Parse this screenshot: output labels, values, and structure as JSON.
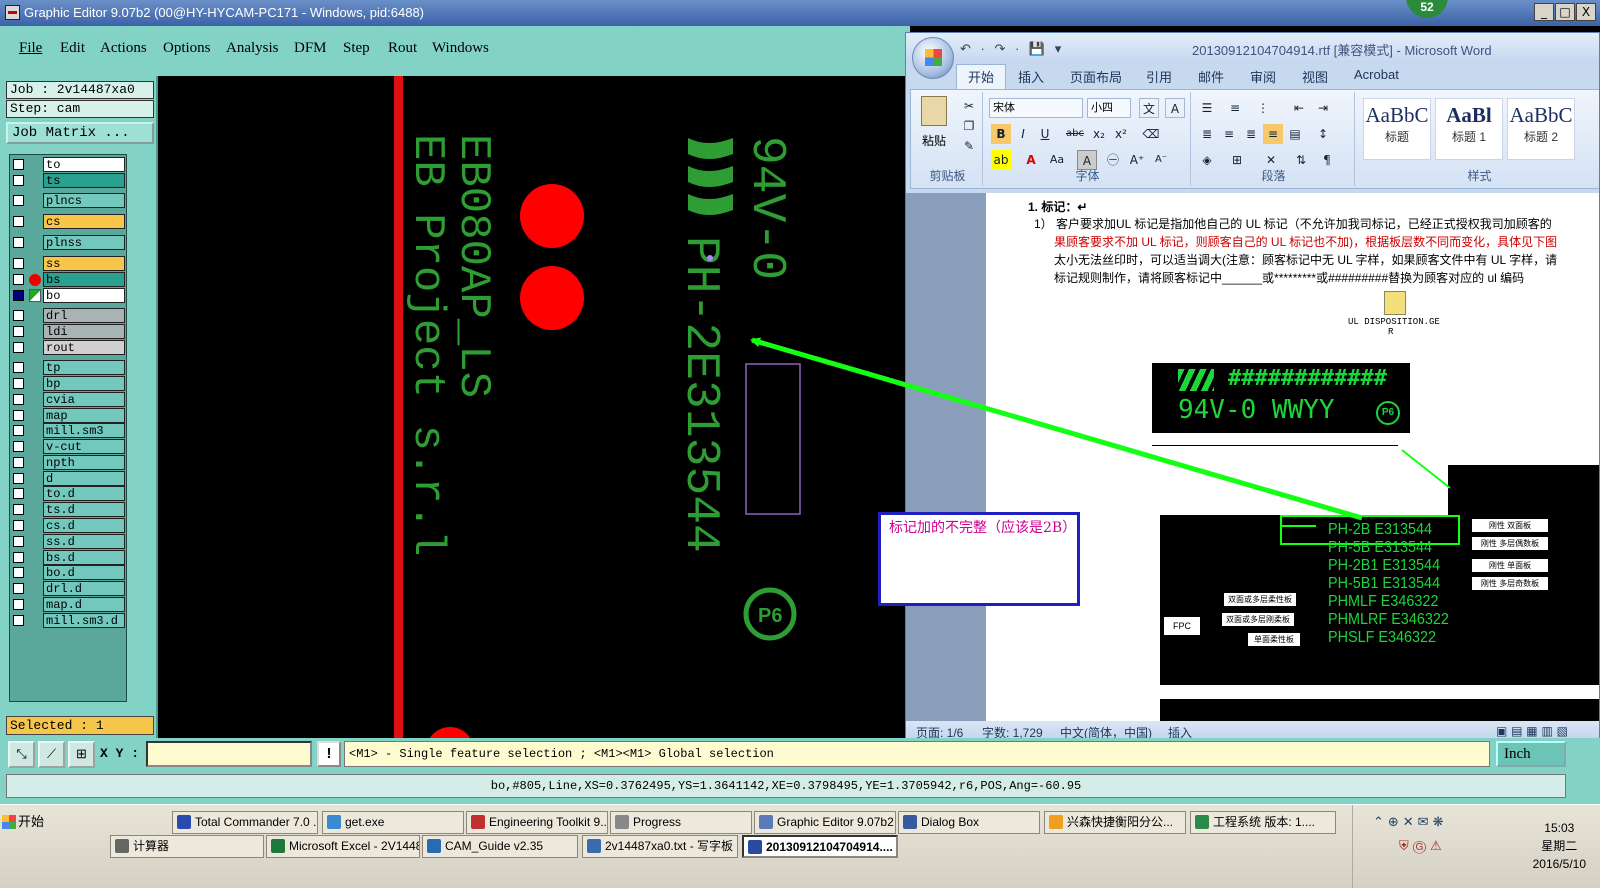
{
  "ge": {
    "title": "Graphic Editor 9.07b2 (00@HY-HYCAM-PC171 - Windows, pid:6488)",
    "window_buttons": [
      "_",
      "□",
      "X"
    ],
    "badge": "52",
    "menus": [
      "File",
      "Edit",
      "Actions",
      "Options",
      "Analysis",
      "DFM",
      "Step",
      "Rout",
      "Windows"
    ],
    "job": "Job : 2v14487xa0",
    "step": "Step: cam",
    "job_matrix": "Job Matrix ...",
    "layers": [
      {
        "name": "to",
        "color": "#ffffff"
      },
      {
        "name": "ts",
        "color": "#2aa090"
      },
      {
        "name": "plncs",
        "color": "#72c8bc"
      },
      {
        "name": "cs",
        "color": "#f6c64a"
      },
      {
        "name": "plnss",
        "color": "#72c8bc"
      },
      {
        "name": "ss",
        "color": "#f6c64a"
      },
      {
        "name": "bs",
        "color": "#2aa090"
      },
      {
        "name": "bo",
        "color": "#ffffff"
      },
      {
        "name": "drl",
        "color": "#a8b4b4"
      },
      {
        "name": "ldi",
        "color": "#a8b4b4"
      },
      {
        "name": "rout",
        "color": "#d0d0d0"
      },
      {
        "name": "tp",
        "color": "#72c8bc"
      },
      {
        "name": "bp",
        "color": "#72c8bc"
      },
      {
        "name": "cvia",
        "color": "#72c8bc"
      },
      {
        "name": "map",
        "color": "#72c8bc"
      },
      {
        "name": "mill.sm3",
        "color": "#72c8bc"
      },
      {
        "name": "v-cut",
        "color": "#72c8bc"
      },
      {
        "name": "npth",
        "color": "#72c8bc"
      },
      {
        "name": "d",
        "color": "#72c8bc"
      },
      {
        "name": "to.d",
        "color": "#72c8bc"
      },
      {
        "name": "ts.d",
        "color": "#72c8bc"
      },
      {
        "name": "cs.d",
        "color": "#72c8bc"
      },
      {
        "name": "ss.d",
        "color": "#72c8bc"
      },
      {
        "name": "bs.d",
        "color": "#72c8bc"
      },
      {
        "name": "bo.d",
        "color": "#72c8bc"
      },
      {
        "name": "drl.d",
        "color": "#72c8bc"
      },
      {
        "name": "map.d",
        "color": "#72c8bc"
      },
      {
        "name": "mill.sm3.d",
        "color": "#72c8bc"
      }
    ],
    "selected": "Selected : 1",
    "canvas_text": {
      "col1": "EB Project s.r.l",
      "col2": "EB080AP_LS",
      "col3": "PH-2E313544",
      "col4": "94V-0",
      "logo_mark": "P6"
    },
    "xy_label": "X Y :",
    "xy_value": "",
    "exclaim": "!",
    "hint": "<M1> - Single feature selection ; <M1><M1> Global selection",
    "units": "Inch",
    "status_line": "bo,#805,Line,XS=0.3762495,YS=1.3641142,XE=0.3798495,YE=1.3705942,r6,POS,Ang=-60.95"
  },
  "word": {
    "title": "20130912104704914.rtf [兼容模式] - Microsoft Word",
    "qat": "↶ · ↷ · 💾 ▾",
    "tabs": [
      "开始",
      "插入",
      "页面布局",
      "引用",
      "邮件",
      "审阅",
      "视图",
      "Acrobat"
    ],
    "ribbon": {
      "clipboard_label": "剪贴板",
      "paste_label": "粘贴",
      "font_label": "字体",
      "font_name": "宋体",
      "font_size": "小四",
      "paragraph_label": "段落",
      "styles_label": "样式",
      "styles": [
        {
          "preview": "AaBbC",
          "name": "标题"
        },
        {
          "preview": "AaBl",
          "name": "标题 1"
        },
        {
          "preview": "AaBbC",
          "name": "标题 2"
        }
      ]
    },
    "doc": {
      "heading": "1.   标记：↵",
      "p1a": "1）     客户要求加UL 标记是指加他自己的 UL 标记（不允许加我司标记，已经正式授权我司加顾客的",
      "p1b": "果顾客要求不加 UL 标记，则顾客自己的 UL 标记也不加)，根据板层数不同而变化，具体见下图",
      "p1c": "太小无法丝印时，可以适当调大(注意：顾客标记中无 UL 字样，如果顾客文件中有 UL 字样，请",
      "p1d": "标记规则制作，请将顾客标记中______或*********或#########替换为顾客对应的 ul 编码",
      "icon_caption_1": "UL DISPOSITION.GE",
      "icon_caption_2": "R",
      "mark_hash": "############",
      "mark_rating": "94V-0 WWYY",
      "mark_logo": "P6",
      "ul_rows": [
        "PH-2B E313544",
        "PH-5B E313544",
        "PH-2B1 E313544",
        "PH-5B1 E313544",
        "PHMLF E346322",
        "PHMLRF E346322",
        "PHSLF E346322"
      ],
      "right_tags": [
        "刚性 双面板",
        "刚性 多层偶数板",
        "刚性 单面板",
        "刚性 多层奇数板"
      ],
      "left_tags": [
        "双面或多层柔性板",
        "双面或多层刚柔板",
        "单面柔性板"
      ],
      "fpc_label": "FPC"
    },
    "status": {
      "page": "页面: 1/6",
      "words": "字数: 1,729",
      "lang": "中文(简体，中国)",
      "mode": "插入"
    }
  },
  "callout": {
    "text": "标记加的不完整（应该是2B）"
  },
  "taskbar": {
    "start": "开始",
    "row1": [
      "Total Commander 7.0 ...",
      "get.exe",
      "Engineering Toolkit 9....",
      "Progress",
      "Graphic Editor 9.07b2 ...",
      "Dialog Box",
      "兴森快捷衡阳分公...",
      "工程系统  版本: 1...."
    ],
    "row2": [
      "计算器",
      "Microsoft Excel - 2V1448...",
      "CAM_Guide v2.35",
      "2v14487xa0.txt - 写字板",
      "20130912104704914...."
    ],
    "time": "15:03",
    "weekday": "星期二",
    "date": "2016/5/10"
  },
  "colors": {
    "accent_green": "#14ff14",
    "callout_border": "#2020c0",
    "callout_text": "#d00090",
    "pad_red": "#ff0000",
    "silk_green": "#2e9e34"
  }
}
